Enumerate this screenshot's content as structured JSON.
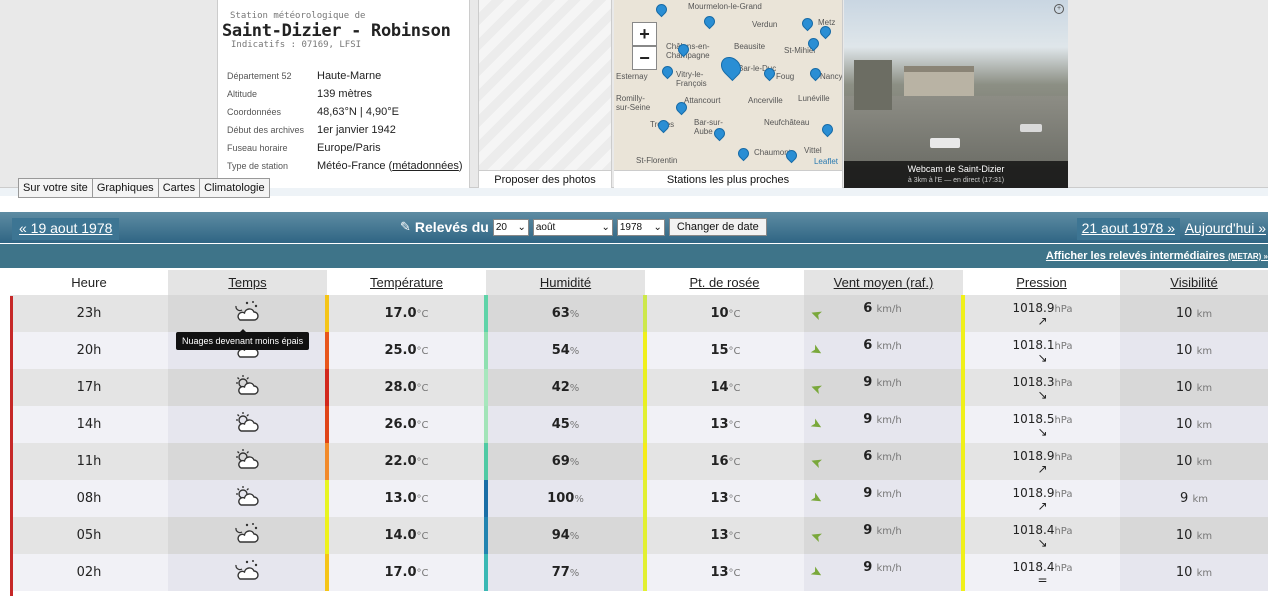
{
  "station": {
    "sup": "Station météorologique de",
    "name": "Saint-Dizier - Robinson",
    "indicatifs": "Indicatifs : 07169, LFSI",
    "info": [
      {
        "k": "Département 52",
        "v": "Haute-Marne"
      },
      {
        "k": "Altitude",
        "v": "139 mètres"
      },
      {
        "k": "Coordonnées",
        "v": "48,63°N | 4,90°E"
      },
      {
        "k": "Début des archives",
        "v": "1er janvier 1942"
      },
      {
        "k": "Fuseau horaire",
        "v": "Europe/Paris"
      },
      {
        "k": "Type de station",
        "v": "Météo-France (",
        "link": "métadonnées",
        "tail": ")"
      }
    ]
  },
  "tabs": [
    "Sur votre site",
    "Graphiques",
    "Cartes",
    "Climatologie"
  ],
  "photos_caption": "Proposer des photos",
  "map": {
    "caption": "Stations les plus proches",
    "zoom_in": "+",
    "zoom_out": "−",
    "attribution": "Leaflet",
    "labels": [
      "Mourmelon-le-Grand",
      "Verdun",
      "Metz",
      "Châlons-en-Champagne",
      "Beausite",
      "St-Mihiel",
      "Vitry-le-François",
      "Bar-le-Duc",
      "Foug",
      "Nancy",
      "Esternay",
      "Romilly-sur-Seine",
      "Attancourt",
      "Ancerville",
      "Lunéville",
      "Troyes",
      "Bar-sur-Aube",
      "Neufchâteau",
      "Chaumont",
      "Vittel",
      "St-Florentin"
    ]
  },
  "webcam": {
    "title": "Webcam de Saint-Dizier",
    "sub": "à 3km à l'E — en direct (17:31)",
    "zoom_icon": "zoom-icon"
  },
  "nav": {
    "prev": "« 19 aout 1978",
    "releves": "Relevés du",
    "day": "20",
    "month": "août",
    "year": "1978",
    "change": "Changer de date",
    "next": "21 aout 1978 »",
    "today": "Aujourd'hui »",
    "metar": "Afficher les relevés intermédiaires",
    "metar_small": "(METAR) »"
  },
  "columns": [
    "Heure",
    "Temps",
    "Température",
    "Humidité",
    "Pt. de rosée",
    "Vent moyen (raf.)",
    "Pression",
    "Visibilité"
  ],
  "units": {
    "temp": "°C",
    "hum": "%",
    "wind": "km/h",
    "pres": "hPa",
    "vis": "km"
  },
  "tooltip": "Nuages devenant moins épais",
  "rows": [
    {
      "heure": "23h",
      "temps": "night-cloud-icon",
      "temp": "17.0",
      "temp_color": "#f5c518",
      "hum": "63",
      "hum_color": "#5fd3a8",
      "rosee": "10",
      "rosee_color": "#cde84a",
      "vent": "6",
      "vent_dir": "➤",
      "pres": "1018.9",
      "pres_trend": "↗",
      "vis": "10"
    },
    {
      "heure": "20h",
      "temps": "night-cloud-icon",
      "temp": "25.0",
      "temp_color": "#e8561c",
      "hum": "54",
      "hum_color": "#8fe0b0",
      "rosee": "15",
      "rosee_color": "#f0f01a",
      "vent": "6",
      "vent_dir": "➤",
      "pres": "1018.1",
      "pres_trend": "↘",
      "vis": "10"
    },
    {
      "heure": "17h",
      "temps": "sun-cloud-icon",
      "temp": "28.0",
      "temp_color": "#d2281c",
      "hum": "42",
      "hum_color": "#a7e7bd",
      "rosee": "14",
      "rosee_color": "#e9f020",
      "vent": "9",
      "vent_dir": "➤",
      "pres": "1018.3",
      "pres_trend": "↘",
      "vis": "10"
    },
    {
      "heure": "14h",
      "temps": "sun-cloud-icon",
      "temp": "26.0",
      "temp_color": "#e04418",
      "hum": "45",
      "hum_color": "#a2e4b8",
      "rosee": "13",
      "rosee_color": "#e2f030",
      "vent": "9",
      "vent_dir": "➤",
      "pres": "1018.5",
      "pres_trend": "↘",
      "vis": "10"
    },
    {
      "heure": "11h",
      "temps": "sun-cloud-icon",
      "temp": "22.0",
      "temp_color": "#f28a2a",
      "hum": "69",
      "hum_color": "#4fcaa4",
      "rosee": "16",
      "rosee_color": "#f5ec18",
      "vent": "6",
      "vent_dir": "➤",
      "pres": "1018.9",
      "pres_trend": "↗",
      "vis": "10"
    },
    {
      "heure": "08h",
      "temps": "sun-cloud-icon",
      "temp": "13.0",
      "temp_color": "#e7f522",
      "hum": "100",
      "hum_color": "#1a6ea6",
      "rosee": "13",
      "rosee_color": "#e2f030",
      "vent": "9",
      "vent_dir": "➤",
      "pres": "1018.9",
      "pres_trend": "↗",
      "vis": "9"
    },
    {
      "heure": "05h",
      "temps": "night-cloud-icon",
      "temp": "14.0",
      "temp_color": "#eef21a",
      "hum": "94",
      "hum_color": "#2284b0",
      "rosee": "13",
      "rosee_color": "#e2f030",
      "vent": "9",
      "vent_dir": "➤",
      "pres": "1018.4",
      "pres_trend": "↘",
      "vis": "10"
    },
    {
      "heure": "02h",
      "temps": "night-cloud-icon",
      "temp": "17.0",
      "temp_color": "#f5c518",
      "hum": "77",
      "hum_color": "#3ab8b4",
      "rosee": "13",
      "rosee_color": "#e2f030",
      "vent": "9",
      "vent_dir": "➤",
      "pres": "1018.4",
      "pres_trend": "=",
      "vis": "10"
    }
  ]
}
